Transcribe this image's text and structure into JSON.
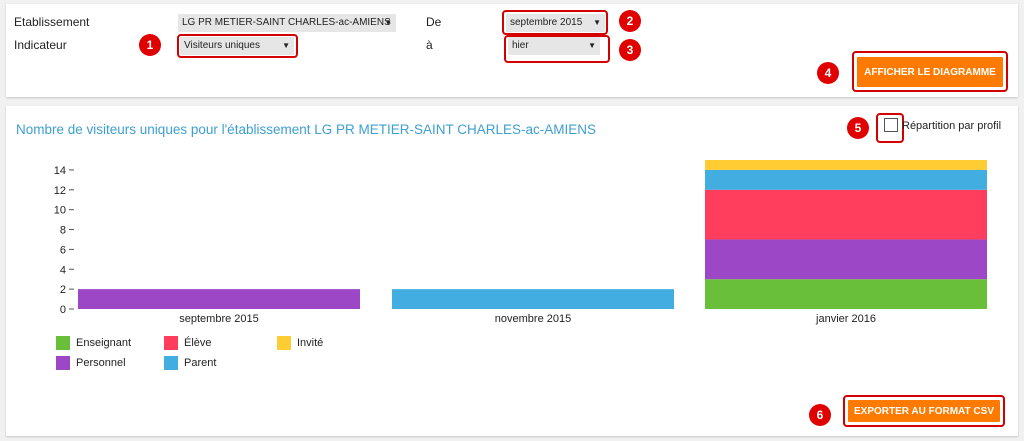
{
  "filters": {
    "establishment_label": "Etablissement",
    "establishment_value": "LG PR METIER-SAINT CHARLES-ac-AMIENS",
    "indicator_label": "Indicateur",
    "indicator_value": "Visiteurs uniques",
    "from_label": "De",
    "from_value": "septembre 2015",
    "to_label": "à",
    "to_value": "hier",
    "show_chart_button": "AFFICHER LE DIAGRAMME"
  },
  "markers": [
    "1",
    "2",
    "3",
    "4",
    "5",
    "6"
  ],
  "chart_panel": {
    "profile_toggle_label": "Répartition par profil",
    "profile_toggle_checked": false,
    "export_button": "EXPORTER AU FORMAT CSV"
  },
  "colors": {
    "accent": "#ff7a00",
    "title": "#3e9fd0",
    "highlight": "#d40000"
  },
  "chart_data": {
    "type": "bar",
    "stacked": true,
    "title": "Nombre de visiteurs uniques pour l'établissement LG PR METIER-SAINT CHARLES-ac-AMIENS",
    "categories": [
      "septembre 2015",
      "novembre 2015",
      "janvier 2016"
    ],
    "series": [
      {
        "name": "Enseignant",
        "color": "#6abf3a",
        "values": [
          0,
          0,
          3
        ]
      },
      {
        "name": "Personnel",
        "color": "#9b47c6",
        "values": [
          2,
          0,
          4
        ]
      },
      {
        "name": "Élève",
        "color": "#ff3d5c",
        "values": [
          0,
          0,
          5
        ]
      },
      {
        "name": "Parent",
        "color": "#41ade0",
        "values": [
          0,
          2,
          2
        ]
      },
      {
        "name": "Invité",
        "color": "#ffcc33",
        "values": [
          0,
          0,
          1
        ]
      }
    ],
    "yticks": [
      0,
      2,
      4,
      6,
      8,
      10,
      12,
      14
    ],
    "ylim": [
      0,
      15
    ],
    "legend_position": "bottom-left",
    "grid": false
  }
}
